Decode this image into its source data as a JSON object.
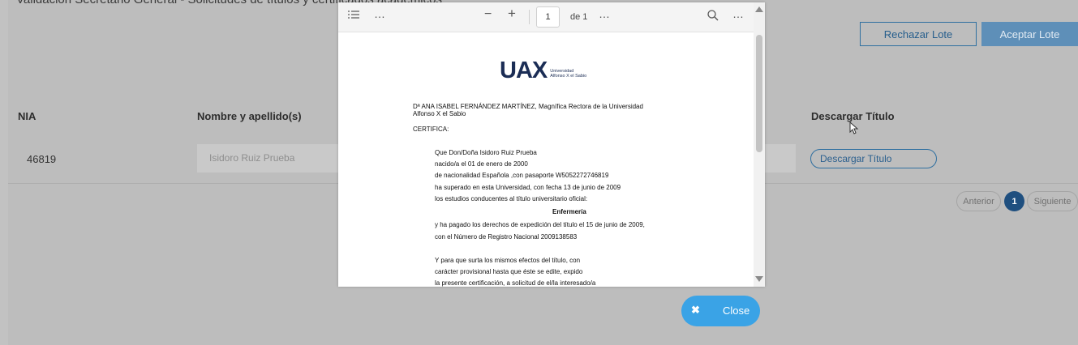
{
  "page": {
    "title": "Validación Secretario General - Solicitudes de títulos y certificados académicos",
    "reject_label": "Rechazar Lote",
    "accept_label": "Aceptar Lote"
  },
  "table": {
    "headers": [
      "NIA",
      "Nombre y apellido(s)",
      "Descargar Título"
    ],
    "rows": [
      {
        "nia": "46819",
        "name": "Isidoro Ruiz Prueba",
        "download_label": "Descargar Título"
      }
    ]
  },
  "pagination": {
    "prev": "Anterior",
    "current": "1",
    "next": "Siguiente"
  },
  "viewer": {
    "toolbar": {
      "outline_icon": "list-icon",
      "more_icon": "…",
      "zoom_out": "−",
      "zoom_in": "+",
      "page_number": "1",
      "page_of": "de 1",
      "search_icon": "search-icon"
    },
    "document": {
      "logo_text": "UAX",
      "logo_sub_1": "Universidad",
      "logo_sub_2": "Alfonso X el Sabio",
      "lines": [
        "Dª ANA ISABEL FERNÁNDEZ MARTÍNEZ, Magnífica Rectora de la Universidad",
        "Alfonso X el Sabio",
        "CERTIFICA:",
        "Que Don/Doña Isidoro Ruiz Prueba",
        "nacido/a el 01 de enero de 2000",
        "de nacionalidad Española ,con pasaporte W5052272746819",
        "ha superado en esta Universidad, con fecha 13 de junio de 2009",
        "los estudios conducentes al título universitario oficial:",
        "Enfermería",
        "y ha pagado los derechos de expedición del título el 15 de junio de 2009,",
        "con el Número de Registro Nacional 2009138583",
        "Y para que surta los mismos efectos del título, con",
        "carácter provisional hasta que éste se edite, expido",
        "la presente certificación, a solicitud de el/la interesado/a"
      ]
    }
  },
  "close_label": "Close",
  "colors": {
    "overlay": "#bdbdbd",
    "primary": "#1f4f7f",
    "close_button": "#3aa3e6"
  }
}
